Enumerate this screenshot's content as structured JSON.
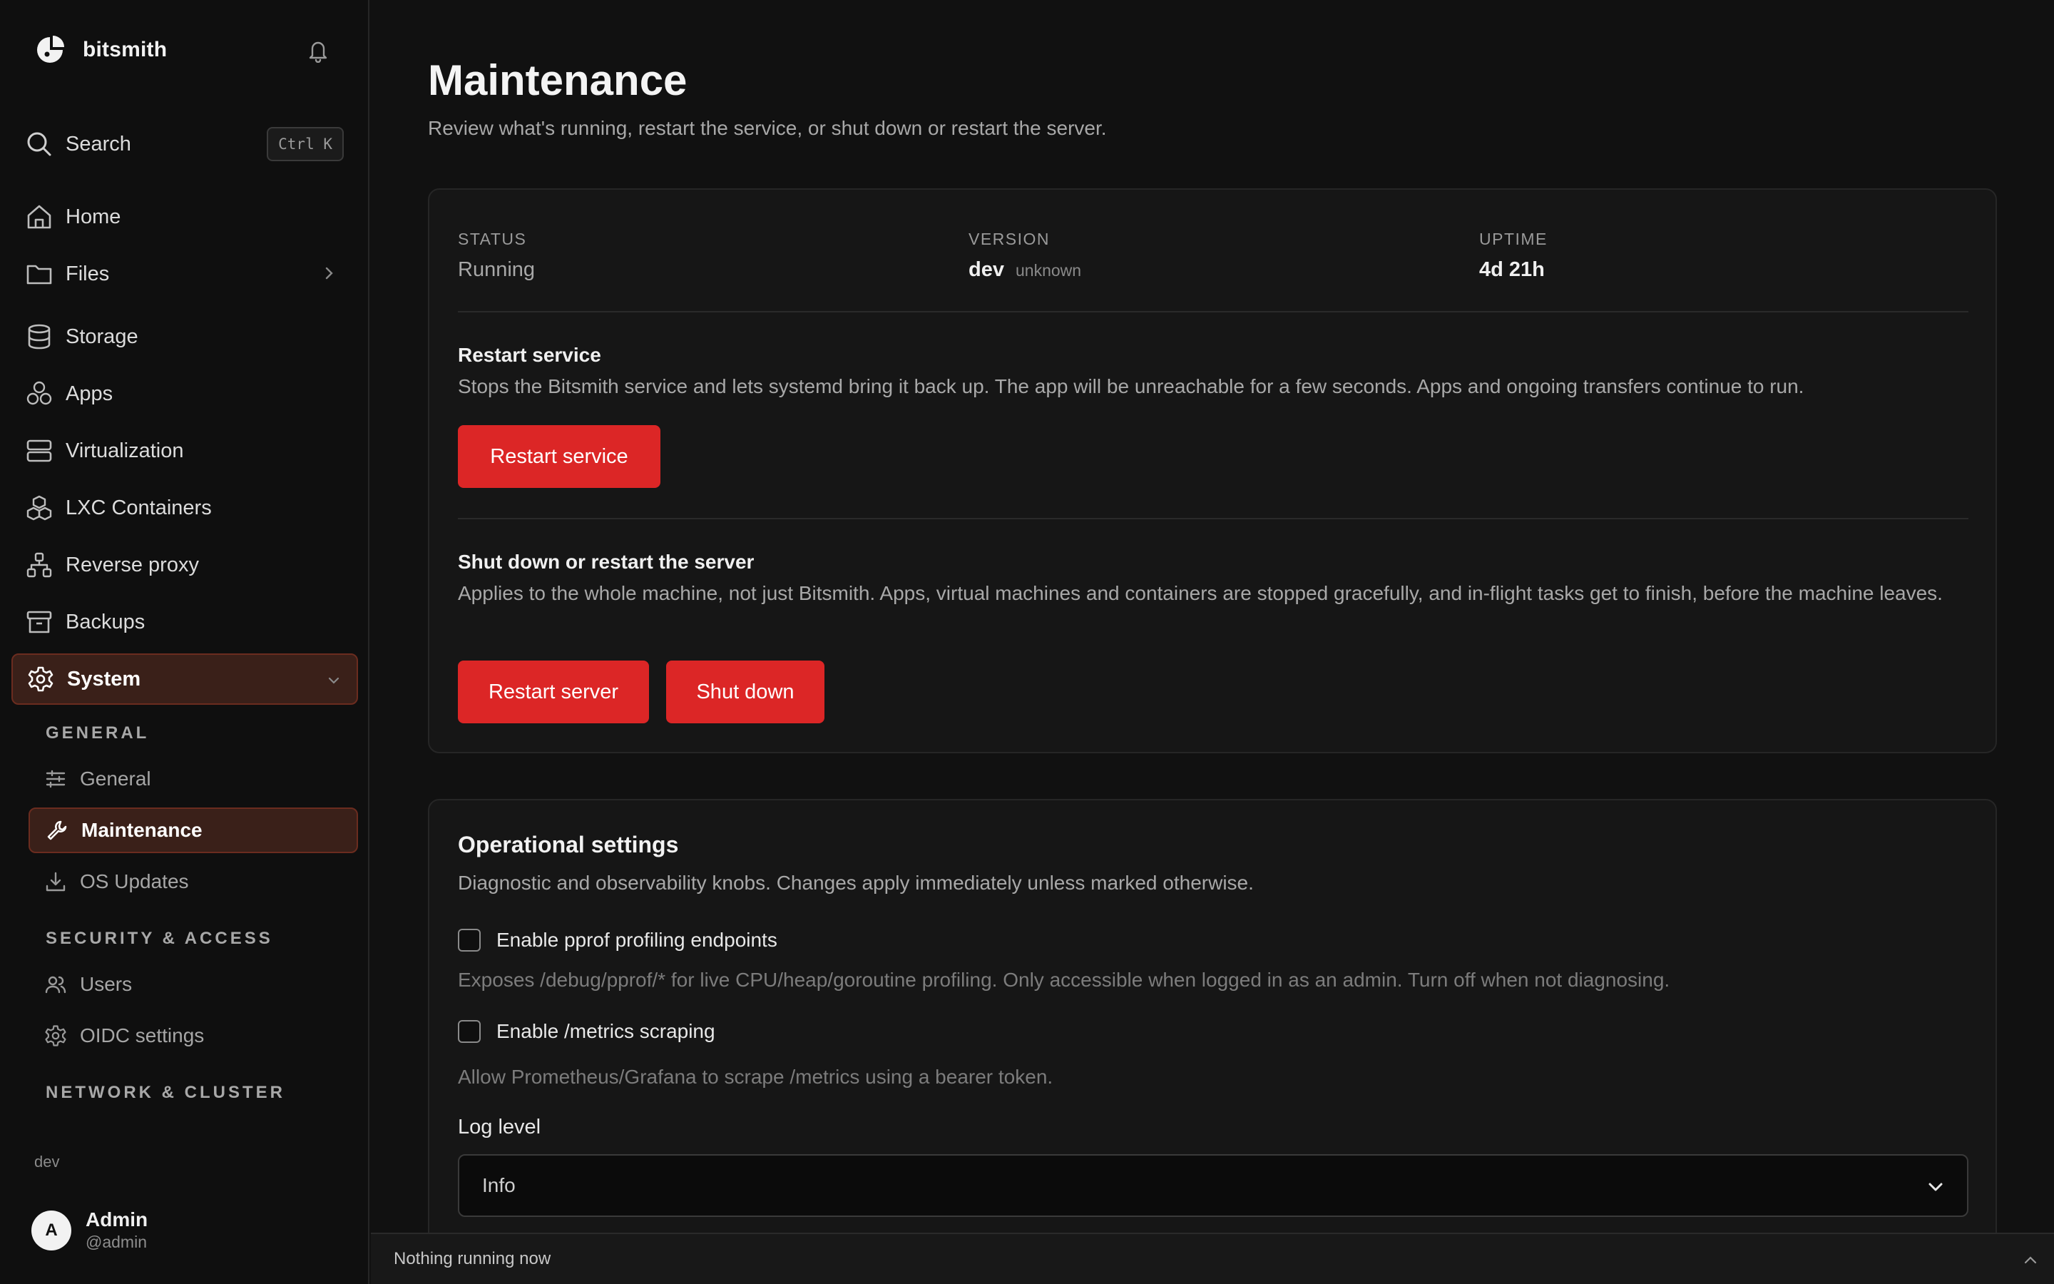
{
  "app": {
    "name": "bitsmith",
    "version_tag": "dev"
  },
  "search": {
    "label": "Search",
    "shortcut": "Ctrl K"
  },
  "sidebar": {
    "nav": [
      {
        "label": "Home",
        "icon": "home-icon"
      },
      {
        "label": "Files",
        "icon": "folder-icon"
      },
      {
        "label": "Storage",
        "icon": "database-icon"
      },
      {
        "label": "Apps",
        "icon": "apps-icon"
      },
      {
        "label": "Virtualization",
        "icon": "server-icon"
      },
      {
        "label": "LXC Containers",
        "icon": "boxes-icon"
      },
      {
        "label": "Reverse proxy",
        "icon": "network-icon"
      },
      {
        "label": "Backups",
        "icon": "archive-icon"
      }
    ],
    "system": {
      "label": "System",
      "icon": "gear-icon"
    },
    "sections": [
      {
        "heading": "GENERAL"
      },
      {
        "heading": "SECURITY & ACCESS"
      },
      {
        "heading": "NETWORK & CLUSTER"
      }
    ],
    "sub_items": [
      {
        "label": "General",
        "icon": "sliders-icon"
      },
      {
        "label": "Maintenance",
        "icon": "wrench-icon"
      },
      {
        "label": "OS Updates",
        "icon": "download-icon"
      },
      {
        "label": "Users",
        "icon": "users-icon"
      },
      {
        "label": "OIDC settings",
        "icon": "cog-icon"
      }
    ]
  },
  "user": {
    "initial": "A",
    "name": "Admin",
    "handle": "@admin"
  },
  "page": {
    "title": "Maintenance",
    "subtitle": "Review what's running, restart the service, or shut down or restart the server."
  },
  "status": {
    "status_label": "STATUS",
    "status_value": "Running",
    "version_label": "VERSION",
    "version_value": "dev",
    "version_note": "unknown",
    "uptime_label": "UPTIME",
    "uptime_value": "4d 21h"
  },
  "restart_service": {
    "title": "Restart service",
    "description": "Stops the Bitsmith service and lets systemd bring it back up. The app will be unreachable for a few seconds. Apps and ongoing transfers continue to run.",
    "button": "Restart service"
  },
  "power": {
    "title": "Shut down or restart the server",
    "description": "Applies to the whole machine, not just Bitsmith. Apps, virtual machines and containers are stopped gracefully, and in-flight tasks get to finish, before the machine leaves.",
    "restart_button": "Restart server",
    "shutdown_button": "Shut down"
  },
  "operational": {
    "title": "Operational settings",
    "description": "Diagnostic and observability knobs. Changes apply immediately unless marked otherwise.",
    "pprof_label": "Enable pprof profiling endpoints",
    "pprof_checked": false,
    "pprof_help": "Exposes /debug/pprof/* for live CPU/heap/goroutine profiling. Only accessible when logged in as an admin. Turn off when not diagnosing.",
    "metrics_label": "Enable /metrics scraping",
    "metrics_checked": false,
    "metrics_help": "Allow Prometheus/Grafana to scrape /metrics using a bearer token.",
    "log_level_label": "Log level",
    "log_level_value": "Info"
  },
  "taskbar": {
    "text": "Nothing running now"
  },
  "colors": {
    "accent_button": "#dc2626",
    "active_nav_bg": "#3a2019",
    "active_nav_border": "#6b2c1f",
    "background": "#111111"
  }
}
